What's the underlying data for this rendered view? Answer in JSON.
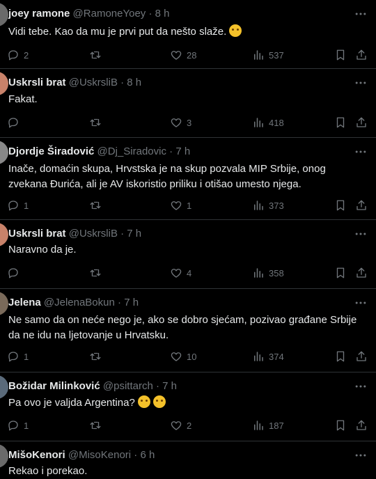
{
  "tweets": [
    {
      "name": "joey ramone",
      "handle": "@RamoneYoey",
      "time": "8 h",
      "dot": "·",
      "text": "Vidi tebe. Kao da mu je prvi put da nešto slaže.",
      "emoji": "wink",
      "replies": "2",
      "retweets": "",
      "likes": "28",
      "views": "537",
      "avatar_color": "#6a6a6a"
    },
    {
      "name": "Uskrsli brat",
      "handle": "@UskrsliB",
      "time": "8 h",
      "dot": "·",
      "text": "Fakat.",
      "emoji": "",
      "replies": "",
      "retweets": "",
      "likes": "3",
      "views": "418",
      "avatar_color": "#c8826a"
    },
    {
      "name": "Djordje Širadović",
      "handle": "@Dj_Siradovic",
      "time": "7 h",
      "dot": "·",
      "text": "Inače, domaćin skupa, Hrvstska je na skup pozvala MIP Srbije, onog zvekana Đurića, ali je AV iskoristio priliku i otišao umesto njega.",
      "emoji": "",
      "replies": "1",
      "retweets": "",
      "likes": "1",
      "views": "373",
      "avatar_color": "#888888"
    },
    {
      "name": "Uskrsli brat",
      "handle": "@UskrsliB",
      "time": "7 h",
      "dot": "·",
      "text": "Naravno da je.",
      "emoji": "",
      "replies": "",
      "retweets": "",
      "likes": "4",
      "views": "358",
      "avatar_color": "#c8826a"
    },
    {
      "name": "Jelena",
      "handle": "@JelenaBokun",
      "time": "7 h",
      "dot": "·",
      "text": "Ne samo da on neće nego je, ako se dobro sjećam, pozivao građane Srbije da ne idu na ljetovanje u Hrvatsku.",
      "emoji": "",
      "replies": "1",
      "retweets": "",
      "likes": "10",
      "views": "374",
      "avatar_color": "#7a6a5a"
    },
    {
      "name": "Božidar Milinković",
      "handle": "@psittarch",
      "time": "7 h",
      "dot": "·",
      "text": "Pa ovo je valjda Argentina?",
      "emoji": "thinking thinking",
      "replies": "1",
      "retweets": "",
      "likes": "2",
      "views": "187",
      "avatar_color": "#5a6a7a"
    },
    {
      "name": "MišoKenori",
      "handle": "@MisoKenori",
      "time": "6 h",
      "dot": "·",
      "text": "Rekao i porekao.",
      "emoji": "",
      "replies": "",
      "retweets": "",
      "likes": "",
      "views": "",
      "avatar_color": "#6a6a6a"
    }
  ],
  "icons": {
    "more": "more-horizontal-icon",
    "reply": "reply-icon",
    "retweet": "retweet-icon",
    "like": "heart-icon",
    "views": "views-icon",
    "bookmark": "bookmark-icon",
    "share": "share-icon"
  },
  "colors": {
    "background": "#000000",
    "text": "#e7e9ea",
    "muted": "#71767b",
    "divider": "#2f3336"
  }
}
